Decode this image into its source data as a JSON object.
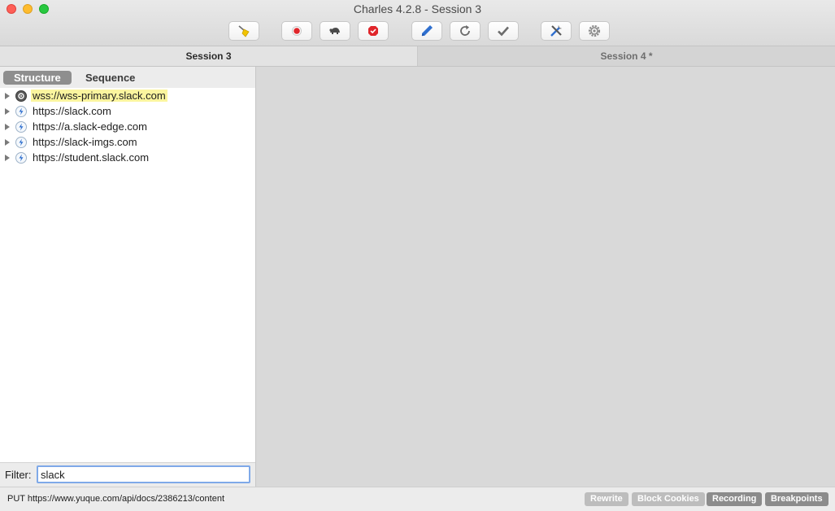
{
  "window": {
    "title": "Charles 4.2.8 - Session 3"
  },
  "toolbar": {
    "buttons": [
      {
        "name": "clear-session",
        "icon": "broom-icon"
      },
      {
        "name": "record",
        "icon": "record-icon"
      },
      {
        "name": "throttle",
        "icon": "turtle-icon"
      },
      {
        "name": "breakpoints",
        "icon": "stop-icon"
      },
      {
        "name": "compose",
        "icon": "pen-icon"
      },
      {
        "name": "repeat",
        "icon": "refresh-icon"
      },
      {
        "name": "validate",
        "icon": "check-icon"
      },
      {
        "name": "tools",
        "icon": "tools-icon"
      },
      {
        "name": "settings",
        "icon": "gear-icon"
      }
    ]
  },
  "tabs": [
    {
      "label": "Session 3",
      "active": true
    },
    {
      "label": "Session 4 *",
      "active": false
    }
  ],
  "left_panel": {
    "view_modes": [
      "Structure",
      "Sequence"
    ],
    "active_mode": "Structure",
    "hosts": [
      {
        "label": "wss://wss-primary.slack.com",
        "type": "websocket",
        "highlighted": true
      },
      {
        "label": "https://slack.com",
        "type": "https",
        "highlighted": false
      },
      {
        "label": "https://a.slack-edge.com",
        "type": "https",
        "highlighted": false
      },
      {
        "label": "https://slack-imgs.com",
        "type": "https",
        "highlighted": false
      },
      {
        "label": "https://student.slack.com",
        "type": "https",
        "highlighted": false
      }
    ],
    "filter": {
      "label": "Filter:",
      "value": "slack"
    }
  },
  "status_bar": {
    "text": "PUT https://www.yuque.com/api/docs/2386213/content",
    "buttons": [
      {
        "label": "Rewrite",
        "state": "off"
      },
      {
        "label": "Block Cookies",
        "state": "off"
      },
      {
        "label": "Recording",
        "state": "on"
      },
      {
        "label": "Breakpoints",
        "state": "on"
      }
    ]
  },
  "colors": {
    "highlight": "#fbf59f",
    "record_red": "#e0262b",
    "accent_blue": "#2f6fcf",
    "focus_ring": "#7fa9e8"
  }
}
